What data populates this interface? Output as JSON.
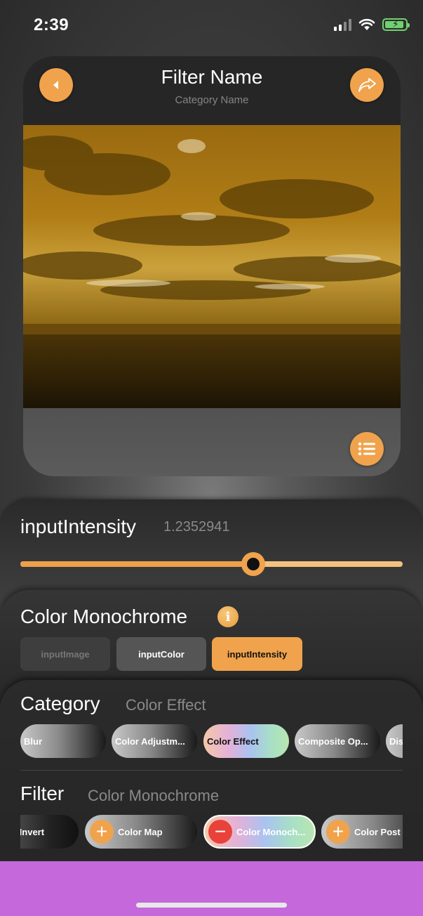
{
  "status_bar": {
    "time": "2:39",
    "icons": [
      "signal-icon",
      "wifi-icon",
      "battery-charging-icon"
    ]
  },
  "preview": {
    "title": "Filter Name",
    "subtitle": "Category Name",
    "back_icon": "back-arrow-icon",
    "share_icon": "share-arrow-icon",
    "menu_icon": "list-icon",
    "image_description_tint": "#b8860b"
  },
  "parameter": {
    "name": "inputIntensity",
    "value": "1.2352941",
    "slider_fraction": 0.61
  },
  "filter_panel": {
    "title": "Color Monochrome",
    "info_glyph": "i",
    "inputs": [
      {
        "label": "inputImage",
        "state": "disabled"
      },
      {
        "label": "inputColor",
        "state": "normal"
      },
      {
        "label": "inputIntensity",
        "state": "selected"
      }
    ]
  },
  "category_section": {
    "label": "Category",
    "value": "Color Effect",
    "chips": [
      "Blur",
      "Color Adjustm...",
      "Color Effect",
      "Composite Op...",
      "Dis"
    ]
  },
  "filter_section": {
    "label": "Filter",
    "value": "Color Monochrome",
    "chips": [
      "r Invert",
      "Color Map",
      "Color Monoch...",
      "Color Post"
    ],
    "plus_glyph": "+",
    "minus_glyph": "−"
  },
  "colors": {
    "accent": "#f0a34c",
    "remove": "#e8423a",
    "home_area": "#c468db"
  }
}
